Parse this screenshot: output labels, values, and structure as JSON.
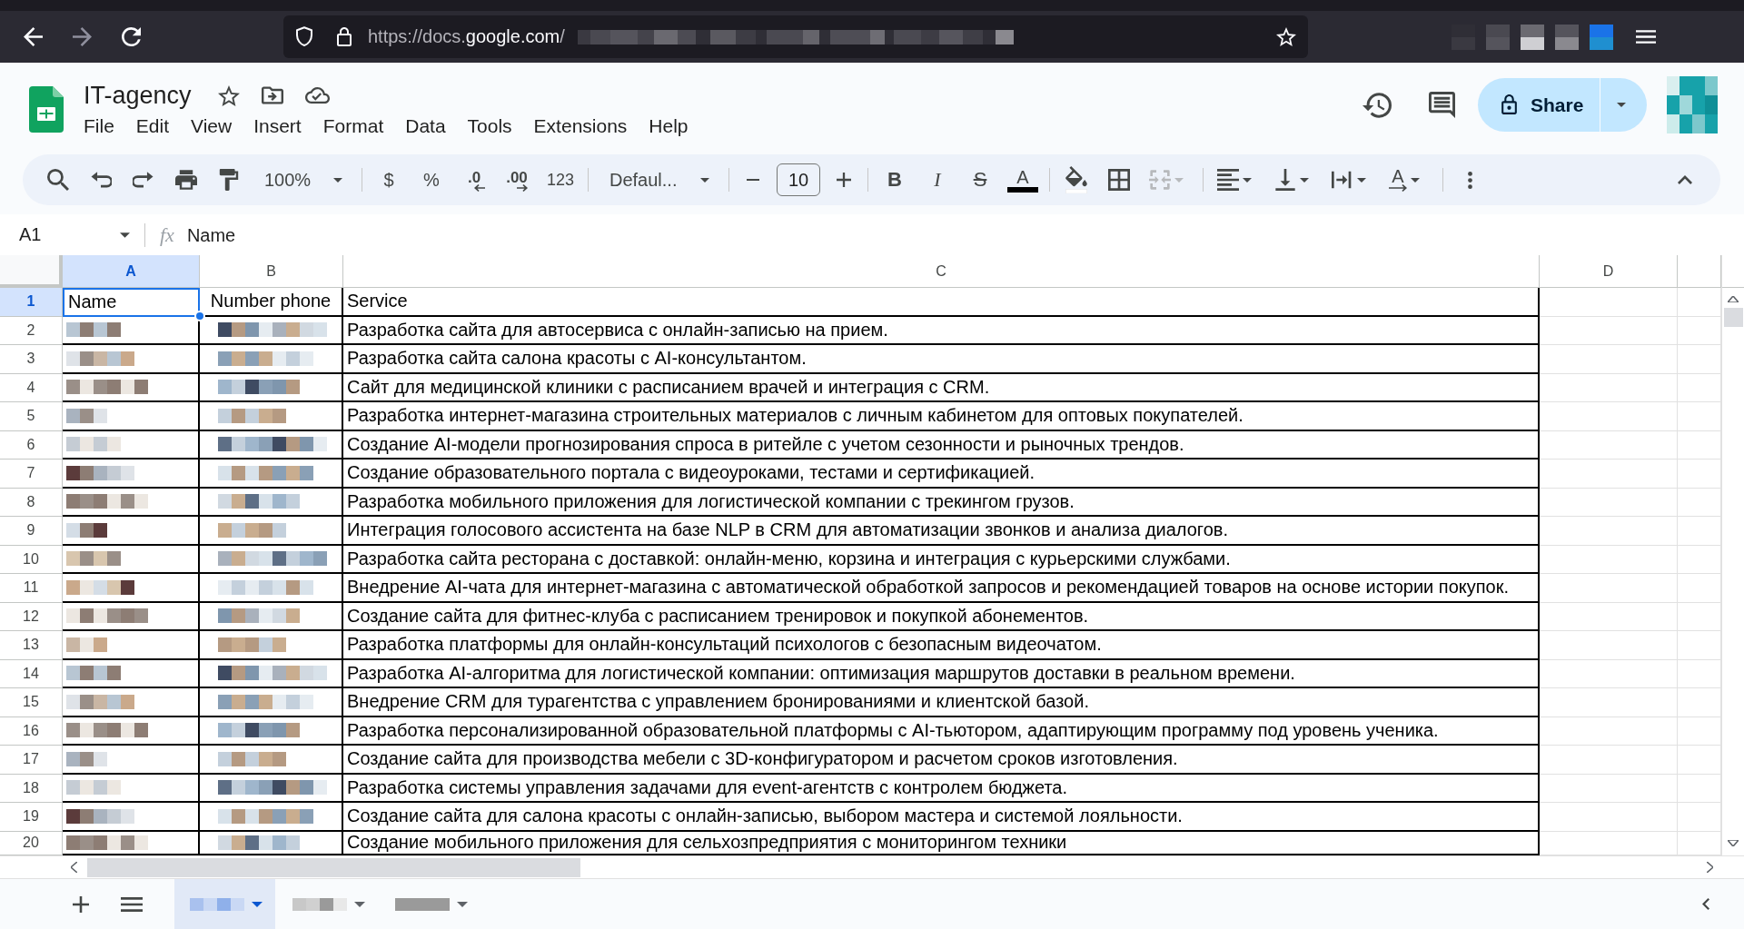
{
  "browser": {
    "url": [
      {
        "text": "https://docs.",
        "highlight": false
      },
      {
        "text": "google.com",
        "highlight": true
      },
      {
        "text": "/",
        "highlight": false
      }
    ]
  },
  "document": {
    "title": "IT-agency"
  },
  "menu": [
    "File",
    "Edit",
    "View",
    "Insert",
    "Format",
    "Data",
    "Tools",
    "Extensions",
    "Help"
  ],
  "share": {
    "label": "Share"
  },
  "toolbar": {
    "zoom": "100%",
    "currency": "$",
    "percent": "%",
    "decimal_decrease": ".0",
    "decimal_increase": ".00",
    "number_format": "123",
    "font": "Defaul...",
    "font_size": "10",
    "bold": "B",
    "italic": "I",
    "strikethrough": "S",
    "text_color": "A",
    "text_rotation": "A",
    "merge_cells": {
      "disabled": true
    }
  },
  "formula_bar": {
    "cell": "A1",
    "fx": "fx",
    "content": "Name"
  },
  "columns": [
    {
      "label": "A",
      "selected": true
    },
    {
      "label": "B",
      "selected": false
    },
    {
      "label": "C",
      "selected": false
    },
    {
      "label": "D",
      "selected": false
    }
  ],
  "rows": [
    {
      "number": "1",
      "selected": true,
      "redacted": false,
      "name": "Name",
      "phone": "Number phone",
      "service": "Service"
    },
    {
      "number": "2",
      "selected": false,
      "redacted": true,
      "service": "Разработка сайта для автосервиса с онлайн-записью на прием."
    },
    {
      "number": "3",
      "selected": false,
      "redacted": true,
      "service": "Разработка сайта салона красоты с AI-консультантом."
    },
    {
      "number": "4",
      "selected": false,
      "redacted": true,
      "service": "Сайт для медицинской клиники с расписанием врачей и интеграция с CRM."
    },
    {
      "number": "5",
      "selected": false,
      "redacted": true,
      "service": "Разработка интернет-магазина строительных материалов с личным кабинетом для оптовых покупателей."
    },
    {
      "number": "6",
      "selected": false,
      "redacted": true,
      "service": "Создание AI-модели прогнозирования спроса в ритейле с учетом сезонности и рыночных трендов."
    },
    {
      "number": "7",
      "selected": false,
      "redacted": true,
      "service": "Создание образовательного портала с видеоуроками, тестами и сертификацией."
    },
    {
      "number": "8",
      "selected": false,
      "redacted": true,
      "service": "Разработка мобильного приложения для логистической компании с трекингом грузов."
    },
    {
      "number": "9",
      "selected": false,
      "redacted": true,
      "service": "Интеграция голосового ассистента на базе NLP в CRM для автоматизации звонков и анализа диалогов."
    },
    {
      "number": "10",
      "selected": false,
      "redacted": true,
      "service": "Разработка сайта ресторана с доставкой: онлайн-меню, корзина и интеграция с курьерскими службами."
    },
    {
      "number": "11",
      "selected": false,
      "redacted": true,
      "service": "Внедрение AI-чата для интернет-магазина с автоматической обработкой запросов и рекомендацией товаров на основе истории покупок."
    },
    {
      "number": "12",
      "selected": false,
      "redacted": true,
      "service": "Создание сайта для фитнес-клуба с расписанием тренировок и покупкой абонементов."
    },
    {
      "number": "13",
      "selected": false,
      "redacted": true,
      "service": "Разработка платформы для онлайн-консультаций психологов с безопасным видеочатом."
    },
    {
      "number": "14",
      "selected": false,
      "redacted": true,
      "service": "Разработка AI-алгоритма для логистической компании: оптимизация маршрутов доставки в реальном времени."
    },
    {
      "number": "15",
      "selected": false,
      "redacted": true,
      "service": "Внедрение CRM для турагентства с управлением бронированиями и клиентской базой."
    },
    {
      "number": "16",
      "selected": false,
      "redacted": true,
      "service": "Разработка персонализированной образовательной платформы с AI-тьютором, адаптирующим программу под уровень ученика."
    },
    {
      "number": "17",
      "selected": false,
      "redacted": true,
      "service": "Создание сайта для производства мебели с 3D-конфигуратором и расчетом сроков изготовления."
    },
    {
      "number": "18",
      "selected": false,
      "redacted": true,
      "service": "Разработка системы управления задачами для event-агентств с контролем бюджета."
    },
    {
      "number": "19",
      "selected": false,
      "redacted": true,
      "service": "Создание сайта для салона красоты с онлайн-записью, выбором мастера и системой лояльности."
    },
    {
      "number": "20",
      "selected": false,
      "redacted": true,
      "service": "Создание мобильного приложения для сельхозпредприятия с мониторингом техники"
    }
  ],
  "sheet_tabs": [
    {
      "selected": true
    },
    {
      "selected": false
    },
    {
      "selected": false
    }
  ]
}
